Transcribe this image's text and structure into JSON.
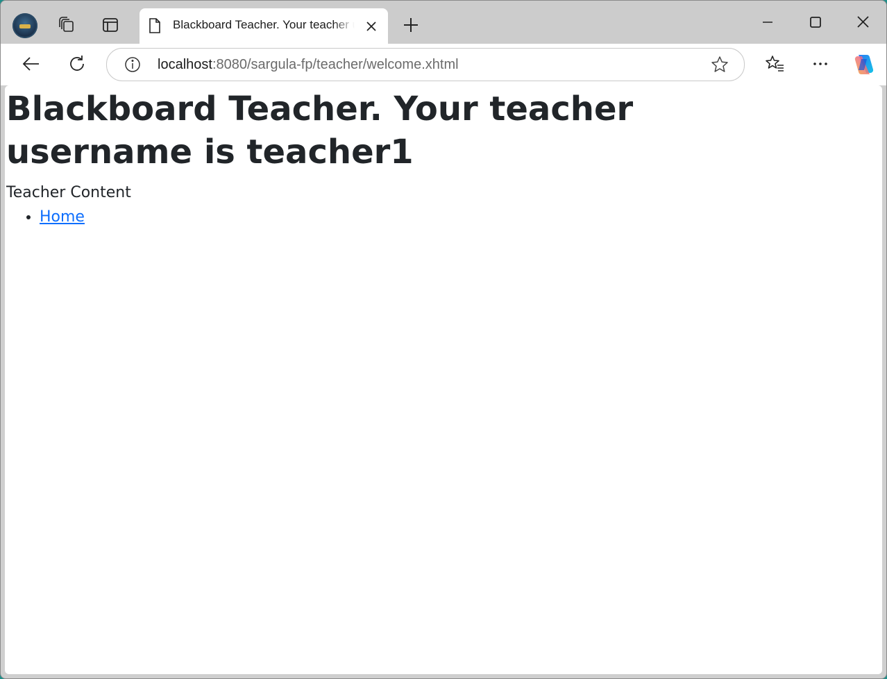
{
  "browser": {
    "tab": {
      "title": "Blackboard Teacher. Your teacher username is teacher1"
    },
    "address": {
      "host": "localhost",
      "path": ":8080/sargula-fp/teacher/welcome.xhtml"
    },
    "icons": {
      "profile": "profile-avatar",
      "workspaces": "workspaces-icon",
      "vertical_tabs": "vertical-tabs-icon",
      "tab_page": "page-icon",
      "tab_close": "close-icon",
      "new_tab": "plus-icon",
      "minimize": "minimize-icon",
      "maximize": "maximize-icon",
      "close_window": "close-icon",
      "back": "back-arrow-icon",
      "refresh": "refresh-icon",
      "site_info": "info-icon",
      "favorite": "star-icon",
      "favorites_list": "favorites-icon",
      "more": "more-icon",
      "copilot": "copilot-icon"
    }
  },
  "page": {
    "heading": "Blackboard Teacher. Your teacher username is teacher1",
    "content_label": "Teacher Content",
    "nav_links": [
      {
        "label": "Home"
      }
    ],
    "colors": {
      "link": "#0d6efd",
      "text": "#212529"
    }
  }
}
